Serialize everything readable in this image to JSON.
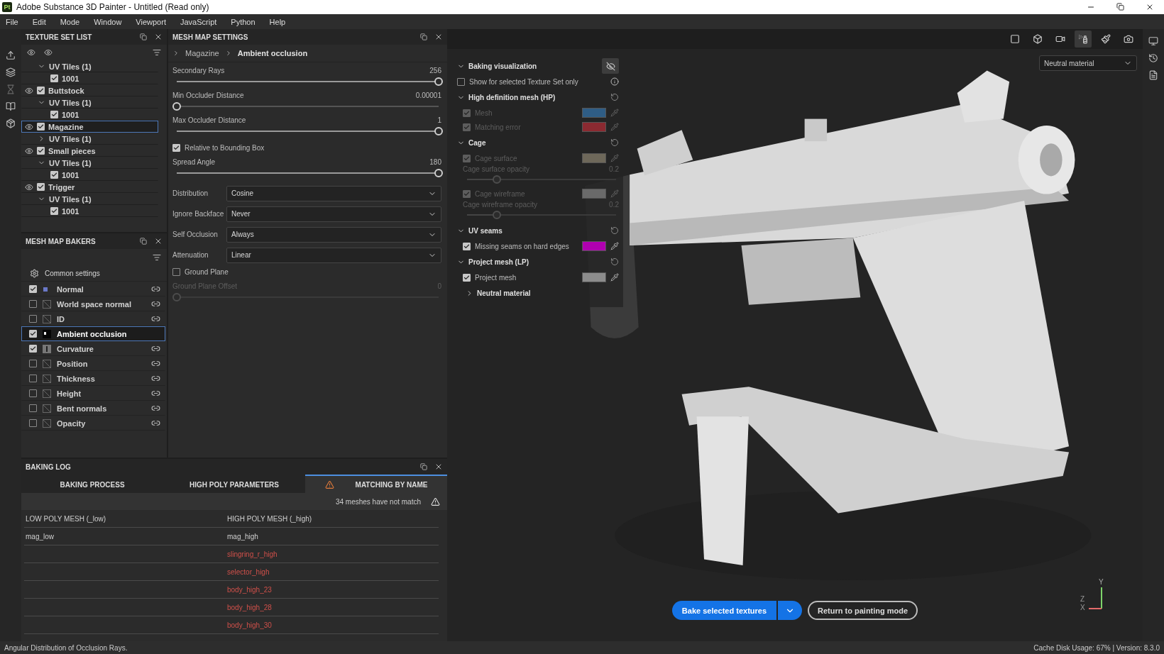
{
  "window": {
    "app_badge": "Pt",
    "title": "Adobe Substance 3D Painter - Untitled (Read only)"
  },
  "menu": [
    "File",
    "Edit",
    "Mode",
    "Window",
    "Viewport",
    "JavaScript",
    "Python",
    "Help"
  ],
  "texture_set_list": {
    "title": "TEXTURE SET LIST",
    "items": [
      {
        "children": [
          {
            "label": "UV Tiles (1)",
            "expanded": true,
            "children": [
              {
                "label": "1001",
                "checked": true
              }
            ]
          }
        ]
      },
      {
        "label": "Buttstock",
        "visible": true,
        "checked": true,
        "selected": false,
        "children": [
          {
            "label": "UV Tiles (1)",
            "expanded": true,
            "children": [
              {
                "label": "1001",
                "checked": true
              }
            ]
          }
        ]
      },
      {
        "label": "Magazine",
        "visible": true,
        "checked": true,
        "selected": true,
        "children": [
          {
            "label": "UV Tiles (1)",
            "expanded": false
          }
        ]
      },
      {
        "label": "Small pieces",
        "visible": true,
        "checked": true,
        "selected": false,
        "children": [
          {
            "label": "UV Tiles (1)",
            "expanded": true,
            "children": [
              {
                "label": "1001",
                "checked": true
              }
            ]
          }
        ]
      },
      {
        "label": "Trigger",
        "visible": true,
        "checked": true,
        "selected": false,
        "children": [
          {
            "label": "UV Tiles (1)",
            "expanded": true,
            "children": [
              {
                "label": "1001",
                "checked": true
              }
            ]
          }
        ]
      }
    ]
  },
  "mesh_map_bakers": {
    "title": "MESH MAP BAKERS",
    "common_settings": "Common settings",
    "bakers": [
      {
        "label": "Normal",
        "checked": true,
        "selected": false,
        "kind": "normal"
      },
      {
        "label": "World space normal",
        "checked": false,
        "selected": false,
        "kind": "blank"
      },
      {
        "label": "ID",
        "checked": false,
        "selected": false,
        "kind": "blank"
      },
      {
        "label": "Ambient occlusion",
        "checked": true,
        "selected": true,
        "kind": "ao"
      },
      {
        "label": "Curvature",
        "checked": true,
        "selected": false,
        "kind": "curvature"
      },
      {
        "label": "Position",
        "checked": false,
        "selected": false,
        "kind": "blank"
      },
      {
        "label": "Thickness",
        "checked": false,
        "selected": false,
        "kind": "blank"
      },
      {
        "label": "Height",
        "checked": false,
        "selected": false,
        "kind": "blank"
      },
      {
        "label": "Bent normals",
        "checked": false,
        "selected": false,
        "kind": "blank"
      },
      {
        "label": "Opacity",
        "checked": false,
        "selected": false,
        "kind": "blank"
      }
    ]
  },
  "mesh_map_settings": {
    "title": "MESH MAP SETTINGS",
    "breadcrumb": [
      "Magazine",
      "Ambient occlusion"
    ],
    "settings": [
      {
        "kind": "slider",
        "label": "Secondary Rays",
        "reading": "256",
        "level": 1,
        "disabled": false
      },
      {
        "kind": "slider",
        "label": "Min Occluder Distance",
        "reading": "0.00001",
        "level": 0,
        "disabled": false
      },
      {
        "kind": "slider",
        "label": "Max Occluder Distance",
        "reading": "1",
        "level": 1,
        "disabled": false
      },
      {
        "kind": "checkbox",
        "label": "Relative to Bounding Box",
        "checked": true
      },
      {
        "kind": "slider",
        "label": "Spread Angle",
        "reading": "180",
        "level": 1,
        "disabled": false
      },
      {
        "kind": "dropdown",
        "label": "Distribution",
        "value": "Cosine"
      },
      {
        "kind": "dropdown",
        "label": "Ignore Backface",
        "value": "Never"
      },
      {
        "kind": "dropdown",
        "label": "Self Occlusion",
        "value": "Always"
      },
      {
        "kind": "dropdown",
        "label": "Attenuation",
        "value": "Linear"
      },
      {
        "kind": "checkbox",
        "label": "Ground Plane",
        "checked": false
      },
      {
        "kind": "slider",
        "label": "Ground Plane Offset",
        "reading": "0",
        "level": 0,
        "disabled": true
      }
    ]
  },
  "baking_log": {
    "title": "BAKING LOG",
    "tabs": [
      {
        "label": "BAKING PROCESS",
        "selected": false,
        "warning": false
      },
      {
        "label": "HIGH POLY PARAMETERS",
        "selected": false,
        "warning": false
      },
      {
        "label": "MATCHING BY NAME",
        "selected": true,
        "warning": true
      }
    ],
    "message": "34 meshes have not match",
    "columns": [
      "LOW POLY MESH (_low)",
      "HIGH POLY MESH (_high)"
    ],
    "rows": [
      {
        "low": "mag_low",
        "high": "mag_high",
        "matched": true
      },
      {
        "high": "slingring_r_high",
        "matched": false
      },
      {
        "high": "selector_high",
        "matched": false
      },
      {
        "high": "body_high_23",
        "matched": false
      },
      {
        "high": "body_high_28",
        "matched": false
      },
      {
        "high": "body_high_30",
        "matched": false
      }
    ]
  },
  "viewport": {
    "tools": [
      {
        "kind": "frame",
        "selected": false
      },
      {
        "kind": "cube",
        "selected": false
      },
      {
        "kind": "camera",
        "selected": false
      },
      {
        "kind": "bake",
        "selected": true
      },
      {
        "kind": "brush",
        "selected": false
      },
      {
        "kind": "screenshot",
        "selected": false
      }
    ],
    "material": "Neutral material",
    "baking_visualization": {
      "title": "Baking visualization",
      "expanded": true,
      "show_selected_only": {
        "label": "Show for selected Texture Set only",
        "checked": false
      },
      "groups": [
        {
          "title": "High definition mesh (HP)",
          "expanded": true,
          "items": [
            {
              "kind": "color",
              "label": "Mesh",
              "checked": true,
              "disabled": true,
              "color": "#2f5d85"
            },
            {
              "kind": "color",
              "label": "Matching error",
              "checked": true,
              "disabled": true,
              "color": "#8b2a31"
            }
          ]
        },
        {
          "title": "Cage",
          "expanded": true,
          "items": [
            {
              "kind": "color",
              "label": "Cage surface",
              "checked": true,
              "disabled": true,
              "color": "#6e685a"
            },
            {
              "kind": "slider",
              "label": "Cage surface opacity",
              "reading": "0.2",
              "level": 0.2,
              "disabled": true
            },
            {
              "kind": "color",
              "label": "Cage wireframe",
              "checked": true,
              "disabled": true,
              "color": "#6a6a6a"
            },
            {
              "kind": "slider",
              "label": "Cage wireframe opacity",
              "reading": "0.2",
              "level": 0.2,
              "disabled": true
            }
          ]
        },
        {
          "title": "UV seams",
          "expanded": true,
          "items": [
            {
              "kind": "color",
              "label": "Missing seams on hard edges",
              "checked": true,
              "disabled": false,
              "color": "#b000b0"
            }
          ]
        },
        {
          "title": "Project mesh (LP)",
          "expanded": true,
          "items": [
            {
              "kind": "color",
              "label": "Project mesh",
              "checked": true,
              "disabled": false,
              "color": "#8c8c8c"
            }
          ]
        },
        {
          "title": "Neutral material",
          "expanded": false
        }
      ]
    },
    "bake_button": "Bake selected textures",
    "return_button": "Return to painting mode",
    "axes": [
      "Y",
      "Z",
      "X"
    ]
  },
  "status_bar": {
    "hint": "Angular Distribution of Occlusion Rays.",
    "cache": "Cache Disk Usage:  67% | Version: 8.3.0"
  }
}
